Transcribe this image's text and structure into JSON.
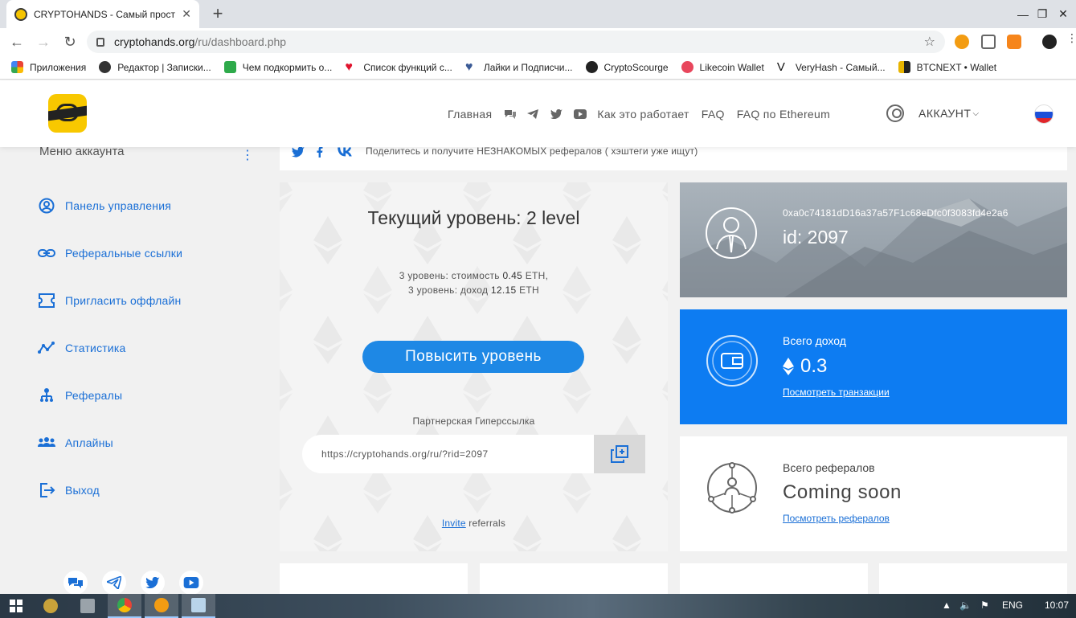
{
  "browser": {
    "tab_title": "CRYPTOHANDS - Самый прост",
    "url_host": "cryptohands.org",
    "url_path": "/ru/dashboard.php",
    "bookmarks": [
      {
        "label": "Приложения",
        "color": "#4285f4"
      },
      {
        "label": "Редактор | Записки...",
        "color": "#333333"
      },
      {
        "label": "Чем подкормить о...",
        "color": "#2eaa4a"
      },
      {
        "label": "Список функций с...",
        "color": "#e0142e"
      },
      {
        "label": "Лайки и Подписчи...",
        "color": "#3b5b96"
      },
      {
        "label": "CryptoScourge",
        "color": "#222222"
      },
      {
        "label": "Likecoin Wallet",
        "color": "#e8465c"
      },
      {
        "label": "VeryHash - Самый...",
        "color": "#111111"
      },
      {
        "label": "BTCNEXT • Wallet",
        "color": "#e8b400"
      }
    ]
  },
  "header": {
    "nav": {
      "home": "Главная",
      "how": "Как это работает",
      "faq": "FAQ",
      "faq_eth": "FAQ по Ethereum"
    },
    "account": "АККАУНТ"
  },
  "sidebar": {
    "title": "Меню аккаунта",
    "items": [
      {
        "label": "Панель управления",
        "icon": "user-circle-icon"
      },
      {
        "label": "Реферальные ссылки",
        "icon": "link-icon"
      },
      {
        "label": "Пригласить оффлайн",
        "icon": "ticket-icon"
      },
      {
        "label": "Статистика",
        "icon": "stats-icon"
      },
      {
        "label": "Рефералы",
        "icon": "hierarchy-icon"
      },
      {
        "label": "Аплайны",
        "icon": "group-icon"
      },
      {
        "label": "Выход",
        "icon": "logout-icon"
      }
    ]
  },
  "share": {
    "text": "Поделитесь и получите НЕЗНАКОМЫХ рефералов ( хэштеги уже ищут)"
  },
  "level": {
    "title": "Текущий уровень: 2 level",
    "line1_prefix": "3 уровень: стоимость ",
    "line1_value": "0.45",
    "line1_suffix": " ETH,",
    "line2_prefix": "3 уровень: доход ",
    "line2_value": "12.15",
    "line2_suffix": " ETH",
    "upgrade_button": "Повысить уровень",
    "ref_label": "Партнерская Гиперссылка",
    "ref_url": "https://cryptohands.org/ru/?rid=2097",
    "invite_link": "Invite",
    "invite_rest": " referrals"
  },
  "profile": {
    "address": "0xa0c74181dD16a37a57F1c68eDfc0f3083fd4e2a6",
    "id": "id: 2097"
  },
  "income": {
    "label": "Всего доход",
    "value": "0.3",
    "link": "Посмотреть транзакции"
  },
  "referrals": {
    "label": "Всего рефералов",
    "value": "Coming soon",
    "link": "Посмотреть рефералов"
  },
  "taskbar": {
    "lang": "ENG",
    "time": "10:07"
  },
  "colors": {
    "accent": "#1e88e5",
    "income_bg": "#0d7cf2",
    "link": "#1a6fd6"
  }
}
